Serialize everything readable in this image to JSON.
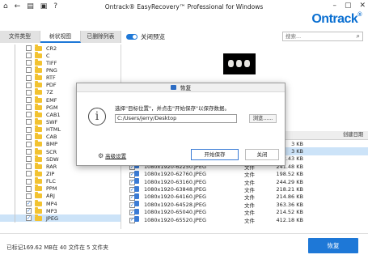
{
  "titlebar": {
    "title": "Ontrack® EasyRecovery™ Professional for Windows",
    "icons": [
      "home-icon",
      "back-icon",
      "file-icon",
      "disk-icon",
      "help-icon"
    ],
    "logo": "Ontrack",
    "logo_mark": "®"
  },
  "tabs": [
    "文件类型",
    "树状视图",
    "已删除列表"
  ],
  "tree": {
    "items": [
      {
        "label": "CR2",
        "checked": false
      },
      {
        "label": "C",
        "checked": false
      },
      {
        "label": "TIFF",
        "checked": false
      },
      {
        "label": "PNG",
        "checked": false
      },
      {
        "label": "RTF",
        "checked": false
      },
      {
        "label": "PDF",
        "checked": false
      },
      {
        "label": "7Z",
        "checked": false
      },
      {
        "label": "EMF",
        "checked": false
      },
      {
        "label": "PGM",
        "checked": false
      },
      {
        "label": "CAB1",
        "checked": false
      },
      {
        "label": "SWF",
        "checked": false
      },
      {
        "label": "HTML",
        "checked": false
      },
      {
        "label": "CAB",
        "checked": false
      },
      {
        "label": "BMP",
        "checked": false
      },
      {
        "label": "SCR",
        "checked": false
      },
      {
        "label": "SDW",
        "checked": false
      },
      {
        "label": "RAR",
        "checked": false
      },
      {
        "label": "ZIP",
        "checked": false
      },
      {
        "label": "FLC",
        "checked": false
      },
      {
        "label": "PPM",
        "checked": false
      },
      {
        "label": "ARJ",
        "checked": false
      },
      {
        "label": "MP4",
        "checked": true
      },
      {
        "label": "MP3",
        "checked": true
      },
      {
        "label": "JPEG",
        "checked": true
      }
    ]
  },
  "preview": {
    "toggle_label": "关闭预览",
    "search_placeholder": "搜索..."
  },
  "table": {
    "headers": [
      "",
      "",
      "",
      "",
      "",
      "",
      "创建日期"
    ],
    "rows": [
      {
        "name": "",
        "type": "",
        "size": "3 KB",
        "selected": false
      },
      {
        "name": "",
        "type": "",
        "size": "3 KB",
        "selected": true
      },
      {
        "name": "1080x1920-61504.JPEG",
        "type": "文件",
        "size": "342.43 KB",
        "selected": false
      },
      {
        "name": "1080x1920-62250.JPEG",
        "type": "文件",
        "size": "241.48 KB",
        "selected": false
      },
      {
        "name": "1080x1920-62760.JPEG",
        "type": "文件",
        "size": "198.52 KB",
        "selected": false
      },
      {
        "name": "1080x1920-63160.JPEG",
        "type": "文件",
        "size": "244.29 KB",
        "selected": false
      },
      {
        "name": "1080x1920-63848.JPEG",
        "type": "文件",
        "size": "218.21 KB",
        "selected": false
      },
      {
        "name": "1080x1920-64160.JPEG",
        "type": "文件",
        "size": "214.86 KB",
        "selected": false
      },
      {
        "name": "1080x1920-64528.JPEG",
        "type": "文件",
        "size": "363.36 KB",
        "selected": false
      },
      {
        "name": "1080x1920-65040.JPEG",
        "type": "文件",
        "size": "214.52 KB",
        "selected": false
      },
      {
        "name": "1080x1920-65520.JPEG",
        "type": "文件",
        "size": "412.18 KB",
        "selected": false
      }
    ]
  },
  "status": {
    "text": "已标记169.62 MB在 40 文件在 5 文件夹",
    "recover_label": "恢复"
  },
  "dialog": {
    "title": "恢复",
    "message": "选择\"目标位置\"，并点击\"开始保存\"以保存数据。",
    "path": "C:/Users/jerry/Desktop",
    "browse_label": "浏览......",
    "advanced_label": "高级设置",
    "start_label": "开始保存",
    "close_label": "关闭"
  },
  "colors": {
    "accent": "#1e78d7",
    "selection": "#cce3f8",
    "folder": "#f2c230"
  }
}
